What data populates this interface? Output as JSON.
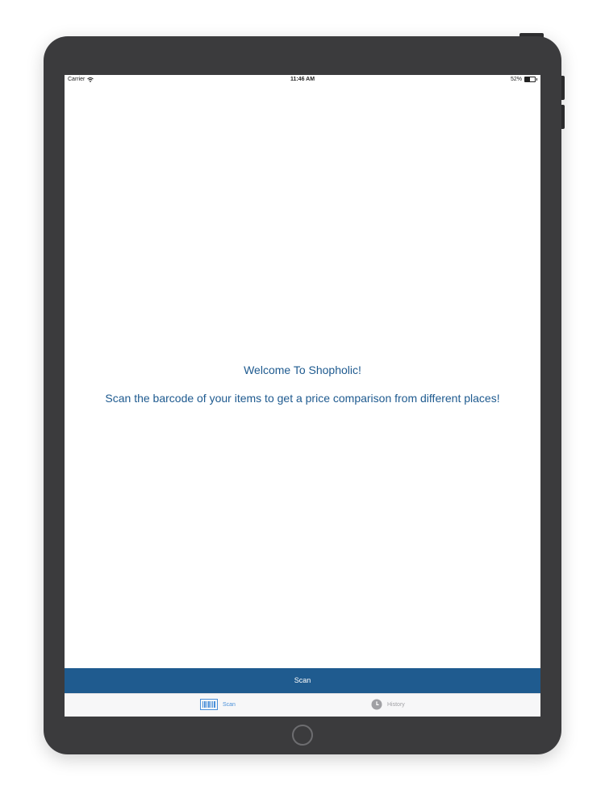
{
  "status_bar": {
    "carrier": "Carrier",
    "time": "11:46 AM",
    "battery": "52%",
    "battery_level": 0.52
  },
  "main": {
    "welcome": "Welcome To Shopholic!",
    "subtitle": "Scan the barcode of your items to get a price comparison from different places!"
  },
  "scan_button": {
    "label": "Scan"
  },
  "tab_bar": {
    "tabs": [
      {
        "label": "Scan",
        "icon": "barcode-icon",
        "selected": true
      },
      {
        "label": "History",
        "icon": "clock-icon",
        "selected": false
      }
    ]
  },
  "colors": {
    "device_frame": "#3b3b3d",
    "accent": "#1f5b8f",
    "text_blue": "#1e5a8f",
    "tab_selected": "#4a90d9",
    "tab_unselected": "#a0a0a4"
  }
}
